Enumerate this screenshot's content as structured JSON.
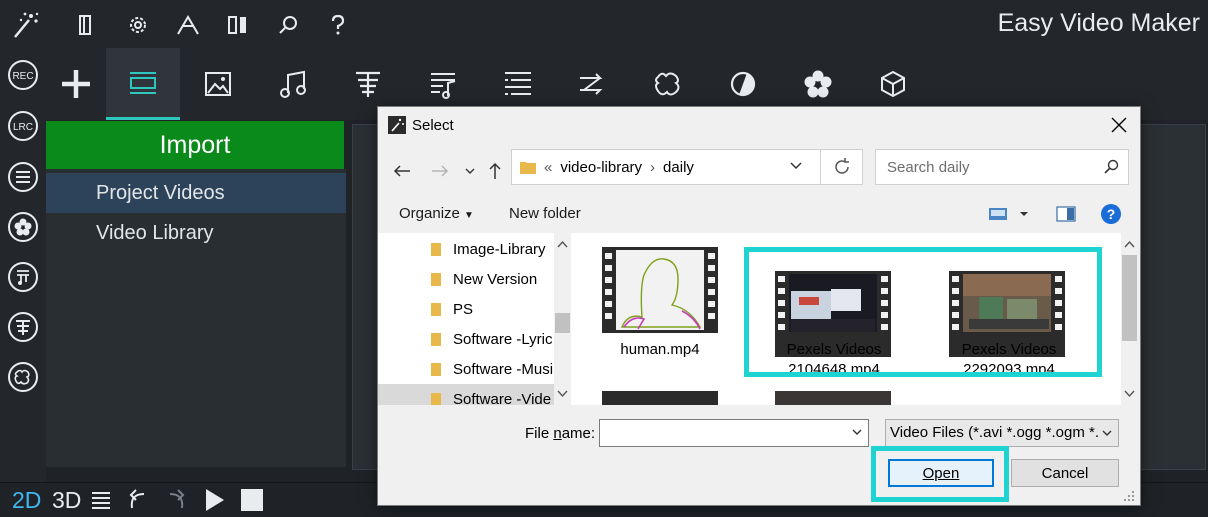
{
  "app": {
    "title": "Easy Video Maker",
    "accent": "#2ec7c0",
    "highlight": "#1fd3d3",
    "import_color": "#0a8a1a"
  },
  "topbar": {
    "icons": [
      "wand-icon",
      "book-icon",
      "gear-icon",
      "compass-icon",
      "split-view-icon",
      "search-icon",
      "help-icon"
    ]
  },
  "leftrail": {
    "items": [
      {
        "label": "REC",
        "icon": "rec-icon"
      },
      {
        "label": "LRC",
        "icon": "lrc-icon"
      },
      {
        "icon": "list-icon"
      },
      {
        "icon": "flower-icon"
      },
      {
        "icon": "music-sheet-icon"
      },
      {
        "icon": "text-icon"
      },
      {
        "icon": "puzzle-icon"
      }
    ]
  },
  "toolbar": {
    "tools": [
      "add-icon",
      "video-tracks-icon",
      "image-icon",
      "music-icon",
      "text-icon",
      "lyrics-icon",
      "list-icon",
      "transition-icon",
      "puzzle-icon",
      "contrast-icon",
      "flower-icon",
      "cube-icon"
    ]
  },
  "import": {
    "button": "Import",
    "items": [
      "Project Videos",
      "Video Library"
    ],
    "selected": 0
  },
  "bottombar": {
    "mode_2d": "2D",
    "mode_3d": "3D"
  },
  "dialog": {
    "title": "Select",
    "breadcrumb": [
      "«",
      "video-library",
      "daily"
    ],
    "search_placeholder": "Search daily",
    "organize": "Organize",
    "new_folder": "New folder",
    "tree": [
      "Image-Library",
      "New Version",
      "PS",
      "Software -Lyric",
      "Software -Musi",
      "Software -Vide"
    ],
    "tree_selected": 5,
    "files": [
      {
        "name1": "human.mp4",
        "name2": ""
      },
      {
        "name1": "Pexels Videos",
        "name2": "2104648.mp4"
      },
      {
        "name1": "Pexels Videos",
        "name2": "2292093.mp4"
      }
    ],
    "file_name_label_pre": "File ",
    "file_name_label_u": "n",
    "file_name_label_post": "ame:",
    "file_name_value": "",
    "file_type": "Video Files (*.avi *.ogg *.ogm *.",
    "open": "Open",
    "cancel": "Cancel"
  }
}
